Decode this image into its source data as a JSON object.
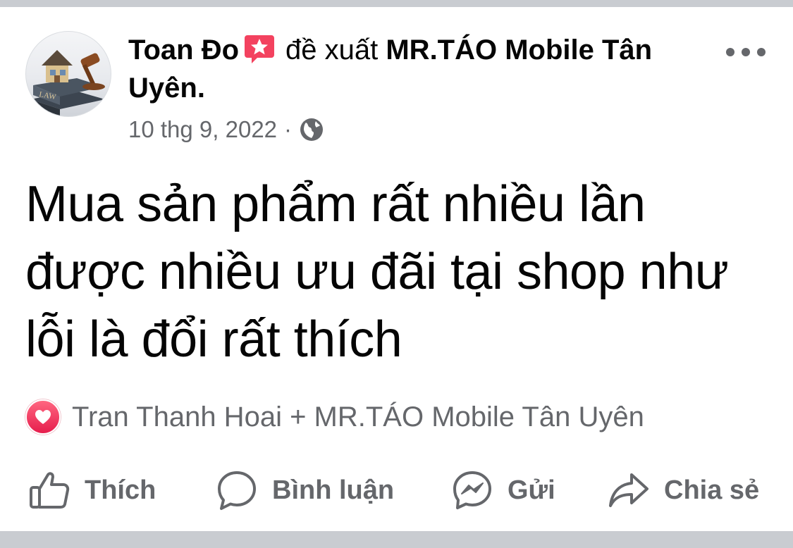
{
  "post": {
    "author": "Toan Đo",
    "verb": "đề xuất",
    "page_name": "MR.TÁO Mobile Tân Uyên.",
    "date": "10 thg 9, 2022",
    "separator": "·",
    "privacy_icon": "globe-icon",
    "avatar_text": "LAW",
    "text": "Mua sản phẩm rất nhiều lần được nhiều ưu đãi tại shop như lỗi là đổi rất thích"
  },
  "reactions": {
    "type_icon": "heart-icon",
    "text": "Tran Thanh Hoai + MR.TÁO Mobile Tân Uyên"
  },
  "actions": {
    "like": "Thích",
    "comment": "Bình luận",
    "send": "Gửi",
    "share": "Chia sẻ"
  },
  "colors": {
    "secondary_text": "#65676b",
    "primary_text": "#050505",
    "heart": "#e61e4d",
    "recommend_badge": "#f3425f",
    "divider": "#c9ccd1"
  }
}
